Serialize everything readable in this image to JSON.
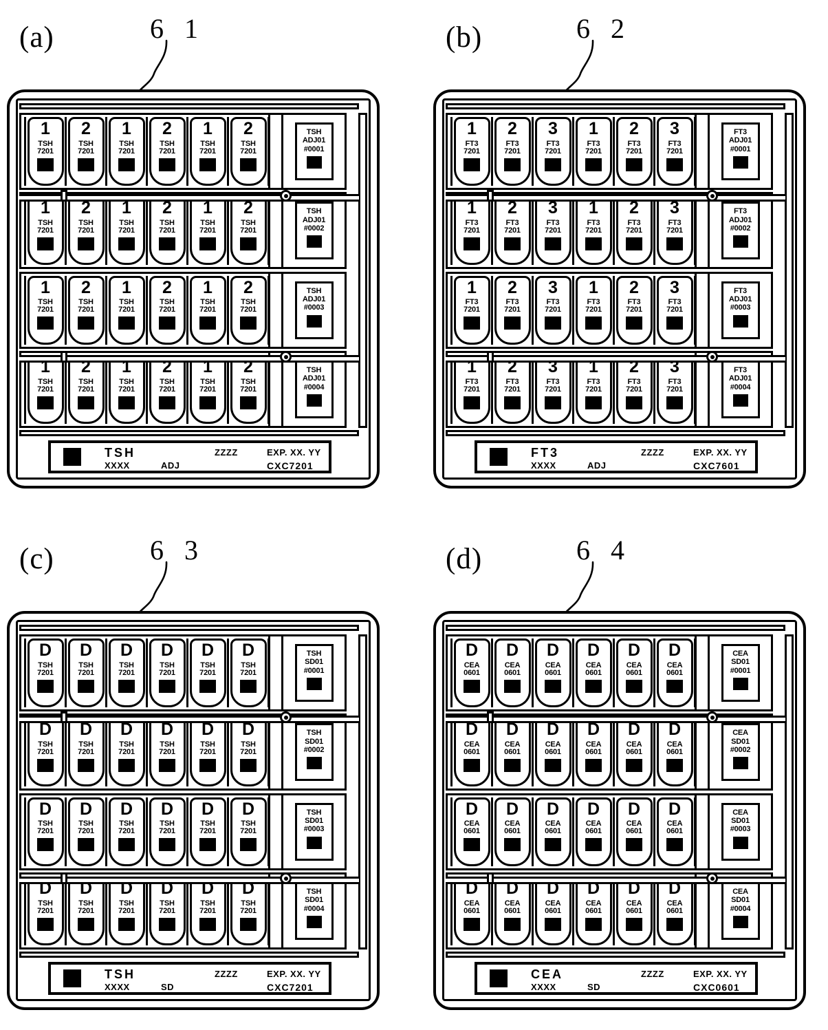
{
  "figure": {
    "panels": [
      {
        "id": "a",
        "letter": "(a)",
        "ref_number": "6 1",
        "tray": {
          "rows": [
            {
              "vials": [
                {
                  "big": "1",
                  "line1": "TSH",
                  "line2": "7201"
                },
                {
                  "big": "2",
                  "line1": "TSH",
                  "line2": "7201"
                },
                {
                  "big": "1",
                  "line1": "TSH",
                  "line2": "7201"
                },
                {
                  "big": "2",
                  "line1": "TSH",
                  "line2": "7201"
                },
                {
                  "big": "1",
                  "line1": "TSH",
                  "line2": "7201"
                },
                {
                  "big": "2",
                  "line1": "TSH",
                  "line2": "7201"
                }
              ],
              "card": {
                "line1": "TSH",
                "line2": "ADJ01",
                "line3": "#0001"
              }
            },
            {
              "vials": [
                {
                  "big": "1",
                  "line1": "TSH",
                  "line2": "7201"
                },
                {
                  "big": "2",
                  "line1": "TSH",
                  "line2": "7201"
                },
                {
                  "big": "1",
                  "line1": "TSH",
                  "line2": "7201"
                },
                {
                  "big": "2",
                  "line1": "TSH",
                  "line2": "7201"
                },
                {
                  "big": "1",
                  "line1": "TSH",
                  "line2": "7201"
                },
                {
                  "big": "2",
                  "line1": "TSH",
                  "line2": "7201"
                }
              ],
              "card": {
                "line1": "TSH",
                "line2": "ADJ01",
                "line3": "#0002"
              }
            },
            {
              "vials": [
                {
                  "big": "1",
                  "line1": "TSH",
                  "line2": "7201"
                },
                {
                  "big": "2",
                  "line1": "TSH",
                  "line2": "7201"
                },
                {
                  "big": "1",
                  "line1": "TSH",
                  "line2": "7201"
                },
                {
                  "big": "2",
                  "line1": "TSH",
                  "line2": "7201"
                },
                {
                  "big": "1",
                  "line1": "TSH",
                  "line2": "7201"
                },
                {
                  "big": "2",
                  "line1": "TSH",
                  "line2": "7201"
                }
              ],
              "card": {
                "line1": "TSH",
                "line2": "ADJ01",
                "line3": "#0003"
              }
            },
            {
              "vials": [
                {
                  "big": "1",
                  "line1": "TSH",
                  "line2": "7201"
                },
                {
                  "big": "2",
                  "line1": "TSH",
                  "line2": "7201"
                },
                {
                  "big": "1",
                  "line1": "TSH",
                  "line2": "7201"
                },
                {
                  "big": "2",
                  "line1": "TSH",
                  "line2": "7201"
                },
                {
                  "big": "1",
                  "line1": "TSH",
                  "line2": "7201"
                },
                {
                  "big": "2",
                  "line1": "TSH",
                  "line2": "7201"
                }
              ],
              "card": {
                "line1": "TSH",
                "line2": "ADJ01",
                "line3": "#0004"
              }
            }
          ],
          "product_label": {
            "name": "TSH",
            "lot": "XXXX",
            "type": "ADJ",
            "zzzz": "ZZZZ",
            "exp": "EXP. XX. YY",
            "code": "CXC7201"
          }
        }
      },
      {
        "id": "b",
        "letter": "(b)",
        "ref_number": "6 2",
        "tray": {
          "rows": [
            {
              "vials": [
                {
                  "big": "1",
                  "line1": "FT3",
                  "line2": "7201"
                },
                {
                  "big": "2",
                  "line1": "FT3",
                  "line2": "7201"
                },
                {
                  "big": "3",
                  "line1": "FT3",
                  "line2": "7201"
                },
                {
                  "big": "1",
                  "line1": "FT3",
                  "line2": "7201"
                },
                {
                  "big": "2",
                  "line1": "FT3",
                  "line2": "7201"
                },
                {
                  "big": "3",
                  "line1": "FT3",
                  "line2": "7201"
                }
              ],
              "card": {
                "line1": "FT3",
                "line2": "ADJ01",
                "line3": "#0001"
              }
            },
            {
              "vials": [
                {
                  "big": "1",
                  "line1": "FT3",
                  "line2": "7201"
                },
                {
                  "big": "2",
                  "line1": "FT3",
                  "line2": "7201"
                },
                {
                  "big": "3",
                  "line1": "FT3",
                  "line2": "7201"
                },
                {
                  "big": "1",
                  "line1": "FT3",
                  "line2": "7201"
                },
                {
                  "big": "2",
                  "line1": "FT3",
                  "line2": "7201"
                },
                {
                  "big": "3",
                  "line1": "FT3",
                  "line2": "7201"
                }
              ],
              "card": {
                "line1": "FT3",
                "line2": "ADJ01",
                "line3": "#0002"
              }
            },
            {
              "vials": [
                {
                  "big": "1",
                  "line1": "FT3",
                  "line2": "7201"
                },
                {
                  "big": "2",
                  "line1": "FT3",
                  "line2": "7201"
                },
                {
                  "big": "3",
                  "line1": "FT3",
                  "line2": "7201"
                },
                {
                  "big": "1",
                  "line1": "FT3",
                  "line2": "7201"
                },
                {
                  "big": "2",
                  "line1": "FT3",
                  "line2": "7201"
                },
                {
                  "big": "3",
                  "line1": "FT3",
                  "line2": "7201"
                }
              ],
              "card": {
                "line1": "FT3",
                "line2": "ADJ01",
                "line3": "#0003"
              }
            },
            {
              "vials": [
                {
                  "big": "1",
                  "line1": "FT3",
                  "line2": "7201"
                },
                {
                  "big": "2",
                  "line1": "FT3",
                  "line2": "7201"
                },
                {
                  "big": "3",
                  "line1": "FT3",
                  "line2": "7201"
                },
                {
                  "big": "1",
                  "line1": "FT3",
                  "line2": "7201"
                },
                {
                  "big": "2",
                  "line1": "FT3",
                  "line2": "7201"
                },
                {
                  "big": "3",
                  "line1": "FT3",
                  "line2": "7201"
                }
              ],
              "card": {
                "line1": "FT3",
                "line2": "ADJ01",
                "line3": "#0004"
              }
            }
          ],
          "product_label": {
            "name": "FT3",
            "lot": "XXXX",
            "type": "ADJ",
            "zzzz": "ZZZZ",
            "exp": "EXP. XX. YY",
            "code": "CXC7601"
          }
        }
      },
      {
        "id": "c",
        "letter": "(c)",
        "ref_number": "6 3",
        "tray": {
          "rows": [
            {
              "vials": [
                {
                  "big": "D",
                  "line1": "TSH",
                  "line2": "7201"
                },
                {
                  "big": "D",
                  "line1": "TSH",
                  "line2": "7201"
                },
                {
                  "big": "D",
                  "line1": "TSH",
                  "line2": "7201"
                },
                {
                  "big": "D",
                  "line1": "TSH",
                  "line2": "7201"
                },
                {
                  "big": "D",
                  "line1": "TSH",
                  "line2": "7201"
                },
                {
                  "big": "D",
                  "line1": "TSH",
                  "line2": "7201"
                }
              ],
              "card": {
                "line1": "TSH",
                "line2": "SD01",
                "line3": "#0001"
              }
            },
            {
              "vials": [
                {
                  "big": "D",
                  "line1": "TSH",
                  "line2": "7201"
                },
                {
                  "big": "D",
                  "line1": "TSH",
                  "line2": "7201"
                },
                {
                  "big": "D",
                  "line1": "TSH",
                  "line2": "7201"
                },
                {
                  "big": "D",
                  "line1": "TSH",
                  "line2": "7201"
                },
                {
                  "big": "D",
                  "line1": "TSH",
                  "line2": "7201"
                },
                {
                  "big": "D",
                  "line1": "TSH",
                  "line2": "7201"
                }
              ],
              "card": {
                "line1": "TSH",
                "line2": "SD01",
                "line3": "#0002"
              }
            },
            {
              "vials": [
                {
                  "big": "D",
                  "line1": "TSH",
                  "line2": "7201"
                },
                {
                  "big": "D",
                  "line1": "TSH",
                  "line2": "7201"
                },
                {
                  "big": "D",
                  "line1": "TSH",
                  "line2": "7201"
                },
                {
                  "big": "D",
                  "line1": "TSH",
                  "line2": "7201"
                },
                {
                  "big": "D",
                  "line1": "TSH",
                  "line2": "7201"
                },
                {
                  "big": "D",
                  "line1": "TSH",
                  "line2": "7201"
                }
              ],
              "card": {
                "line1": "TSH",
                "line2": "SD01",
                "line3": "#0003"
              }
            },
            {
              "vials": [
                {
                  "big": "D",
                  "line1": "TSH",
                  "line2": "7201"
                },
                {
                  "big": "D",
                  "line1": "TSH",
                  "line2": "7201"
                },
                {
                  "big": "D",
                  "line1": "TSH",
                  "line2": "7201"
                },
                {
                  "big": "D",
                  "line1": "TSH",
                  "line2": "7201"
                },
                {
                  "big": "D",
                  "line1": "TSH",
                  "line2": "7201"
                },
                {
                  "big": "D",
                  "line1": "TSH",
                  "line2": "7201"
                }
              ],
              "card": {
                "line1": "TSH",
                "line2": "SD01",
                "line3": "#0004"
              }
            }
          ],
          "product_label": {
            "name": "TSH",
            "lot": "XXXX",
            "type": "SD",
            "zzzz": "ZZZZ",
            "exp": "EXP. XX. YY",
            "code": "CXC7201"
          }
        }
      },
      {
        "id": "d",
        "letter": "(d)",
        "ref_number": "6 4",
        "tray": {
          "rows": [
            {
              "vials": [
                {
                  "big": "D",
                  "line1": "CEA",
                  "line2": "0601"
                },
                {
                  "big": "D",
                  "line1": "CEA",
                  "line2": "0601"
                },
                {
                  "big": "D",
                  "line1": "CEA",
                  "line2": "0601"
                },
                {
                  "big": "D",
                  "line1": "CEA",
                  "line2": "0601"
                },
                {
                  "big": "D",
                  "line1": "CEA",
                  "line2": "0601"
                },
                {
                  "big": "D",
                  "line1": "CEA",
                  "line2": "0601"
                }
              ],
              "card": {
                "line1": "CEA",
                "line2": "SD01",
                "line3": "#0001"
              }
            },
            {
              "vials": [
                {
                  "big": "D",
                  "line1": "CEA",
                  "line2": "0601"
                },
                {
                  "big": "D",
                  "line1": "CEA",
                  "line2": "0601"
                },
                {
                  "big": "D",
                  "line1": "CEA",
                  "line2": "0601"
                },
                {
                  "big": "D",
                  "line1": "CEA",
                  "line2": "0601"
                },
                {
                  "big": "D",
                  "line1": "CEA",
                  "line2": "0601"
                },
                {
                  "big": "D",
                  "line1": "CEA",
                  "line2": "0601"
                }
              ],
              "card": {
                "line1": "CEA",
                "line2": "SD01",
                "line3": "#0002"
              }
            },
            {
              "vials": [
                {
                  "big": "D",
                  "line1": "CEA",
                  "line2": "0601"
                },
                {
                  "big": "D",
                  "line1": "CEA",
                  "line2": "0601"
                },
                {
                  "big": "D",
                  "line1": "CEA",
                  "line2": "0601"
                },
                {
                  "big": "D",
                  "line1": "CEA",
                  "line2": "0601"
                },
                {
                  "big": "D",
                  "line1": "CEA",
                  "line2": "0601"
                },
                {
                  "big": "D",
                  "line1": "CEA",
                  "line2": "0601"
                }
              ],
              "card": {
                "line1": "CEA",
                "line2": "SD01",
                "line3": "#0003"
              }
            },
            {
              "vials": [
                {
                  "big": "D",
                  "line1": "CEA",
                  "line2": "0601"
                },
                {
                  "big": "D",
                  "line1": "CEA",
                  "line2": "0601"
                },
                {
                  "big": "D",
                  "line1": "CEA",
                  "line2": "0601"
                },
                {
                  "big": "D",
                  "line1": "CEA",
                  "line2": "0601"
                },
                {
                  "big": "D",
                  "line1": "CEA",
                  "line2": "0601"
                },
                {
                  "big": "D",
                  "line1": "CEA",
                  "line2": "0601"
                }
              ],
              "card": {
                "line1": "CEA",
                "line2": "SD01",
                "line3": "#0004"
              }
            }
          ],
          "product_label": {
            "name": "CEA",
            "lot": "XXXX",
            "type": "SD",
            "zzzz": "ZZZZ",
            "exp": "EXP. XX. YY",
            "code": "CXC0601"
          }
        }
      }
    ]
  }
}
